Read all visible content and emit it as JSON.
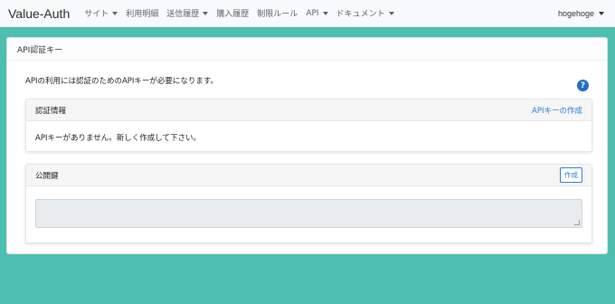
{
  "navbar": {
    "brand": "Value-Auth",
    "items": [
      {
        "label": "サイト",
        "dropdown": true
      },
      {
        "label": "利用明細",
        "dropdown": false
      },
      {
        "label": "送信履歴",
        "dropdown": true
      },
      {
        "label": "購入履歴",
        "dropdown": false
      },
      {
        "label": "制限ルール",
        "dropdown": false
      },
      {
        "label": "API",
        "dropdown": true
      },
      {
        "label": "ドキュメント",
        "dropdown": true
      }
    ],
    "user": "hogehoge"
  },
  "page": {
    "title": "API認証キー",
    "intro": "APIの利用には認証のためのAPIキーが必要になります。",
    "help_icon": "question-circle-icon"
  },
  "auth_card": {
    "title": "認証情報",
    "create_link": "APIキーの作成",
    "message": "APIキーがありません。新しく作成して下さい。"
  },
  "key_card": {
    "title": "公開鍵",
    "create_button": "作成",
    "textarea_value": ""
  },
  "colors": {
    "background": "#4dbfb1",
    "accent": "#2c7bd6",
    "help_icon": "#1e6fc8"
  }
}
